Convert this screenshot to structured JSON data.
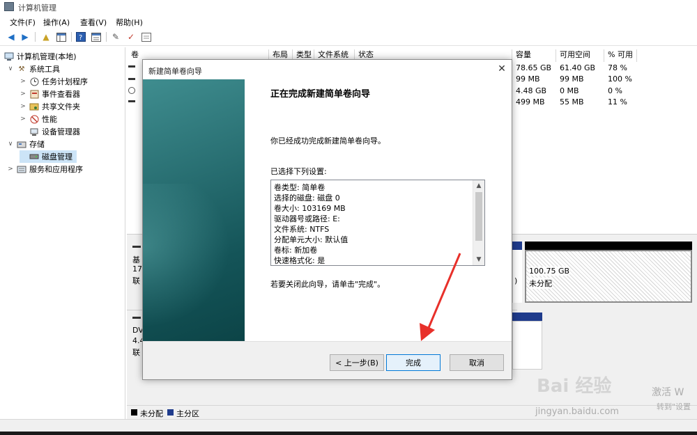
{
  "window": {
    "title": "计算机管理"
  },
  "menu": [
    "文件(F)",
    "操作(A)",
    "查看(V)",
    "帮助(H)"
  ],
  "toolbar": {
    "icons": [
      "back-icon",
      "forward-icon",
      "up-folder-icon",
      "show-hide-tree-icon",
      "help-icon",
      "properties-icon",
      "connect-icon",
      "check-icon",
      "console-icon"
    ]
  },
  "tree": {
    "root": "计算机管理(本地)",
    "items": [
      {
        "label": "系统工具",
        "icon": "tools-icon"
      },
      {
        "label": "任务计划程序",
        "icon": "clock-icon"
      },
      {
        "label": "事件查看器",
        "icon": "event-viewer-icon"
      },
      {
        "label": "共享文件夹",
        "icon": "shared-folder-icon"
      },
      {
        "label": "性能",
        "icon": "performance-icon"
      },
      {
        "label": "设备管理器",
        "icon": "device-manager-icon"
      },
      {
        "label": "存储",
        "icon": "storage-icon"
      },
      {
        "label": "磁盘管理",
        "icon": "disk-icon"
      },
      {
        "label": "服务和应用程序",
        "icon": "services-icon"
      }
    ]
  },
  "volume_list": {
    "headers": [
      "卷",
      "布局",
      "类型",
      "文件系统",
      "状态",
      "容量",
      "可用空间",
      "% 可用"
    ],
    "rows": [
      {
        "capacity": "78.65 GB",
        "free": "61.40 GB",
        "pct": "78 %"
      },
      {
        "capacity": "99 MB",
        "free": "99 MB",
        "pct": "100 %"
      },
      {
        "capacity": "4.48 GB",
        "free": "0 MB",
        "pct": "0 %"
      },
      {
        "capacity": "499 MB",
        "free": "55 MB",
        "pct": "11 %"
      }
    ]
  },
  "disk_area": {
    "disk0_fragments": [
      "基",
      "17",
      "联"
    ],
    "dvd_fragments": [
      "DV",
      "4.4",
      "联"
    ],
    "unallocated_size": "100.75 GB",
    "unallocated_label": "未分配",
    "paren": ")"
  },
  "legend": [
    {
      "label": "未分配",
      "color": "#000000"
    },
    {
      "label": "主分区",
      "color": "#1f3b8c"
    }
  ],
  "dialog": {
    "title": "新建简单卷向导",
    "heading": "正在完成新建简单卷向导",
    "intro": "你已经成功完成新建简单卷向导。",
    "settings_label": "已选择下列设置:",
    "settings": [
      "卷类型: 简单卷",
      "选择的磁盘: 磁盘 0",
      "卷大小: 103169 MB",
      "驱动器号或路径: E:",
      "文件系统: NTFS",
      "分配单元大小: 默认值",
      "卷标: 新加卷",
      "快速格式化: 是"
    ],
    "close_hint": "若要关闭此向导，请单击\"完成\"。",
    "buttons": {
      "back": "< 上一步(B)",
      "finish": "完成",
      "cancel": "取消"
    }
  },
  "watermark": {
    "brand": "Bai  经验",
    "url": "jingyan.baidu.com",
    "activate": "激活 W",
    "goto": "转到\"设置"
  }
}
